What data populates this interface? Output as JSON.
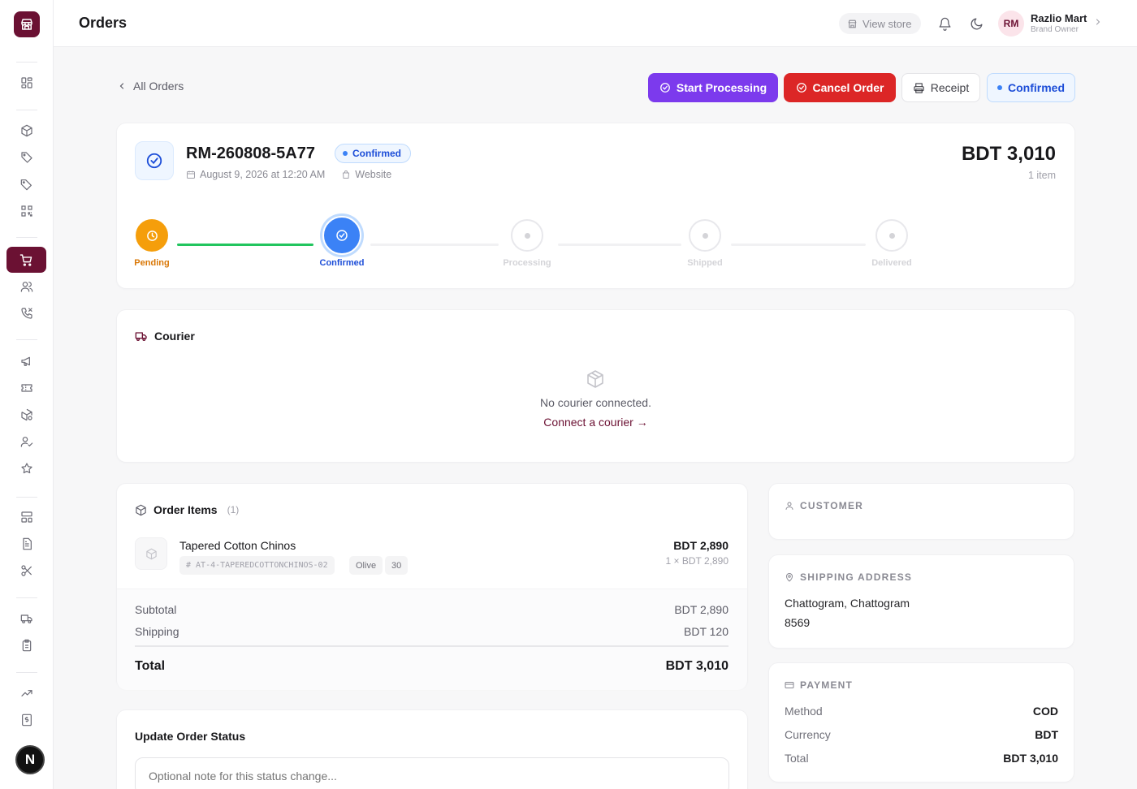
{
  "app": {
    "logo": "store-logo-icon"
  },
  "sidebar": {
    "icons": [
      "dashboard-icon",
      "package-icon",
      "tag-icon",
      "tags-icon",
      "qr-icon",
      "cart-icon",
      "users-icon",
      "phone-icon",
      "megaphone-icon",
      "ticket-icon",
      "box-gear-icon",
      "user-check-icon",
      "star-icon",
      "layout-icon",
      "document-icon",
      "scissors-icon",
      "truck-icon",
      "clipboard-icon",
      "trending-icon",
      "invoice-icon",
      "folder-icon"
    ],
    "active": "cart-icon",
    "avatar_letter": "N"
  },
  "header": {
    "title": "Orders",
    "view_store": "View store",
    "user": {
      "initials": "RM",
      "name": "Razlio Mart",
      "role": "Brand Owner"
    }
  },
  "actions": {
    "back": "All Orders",
    "start_processing": "Start Processing",
    "cancel_order": "Cancel Order",
    "receipt": "Receipt",
    "status": "Confirmed"
  },
  "order": {
    "id": "RM-260808-5A77",
    "status": "Confirmed",
    "date": "August 9, 2026 at 12:20 AM",
    "source": "Website",
    "total": "BDT 3,010",
    "item_count": "1 item",
    "steps": [
      {
        "label": "Pending",
        "state": "done"
      },
      {
        "label": "Confirmed",
        "state": "current"
      },
      {
        "label": "Processing",
        "state": "todo"
      },
      {
        "label": "Shipped",
        "state": "todo"
      },
      {
        "label": "Delivered",
        "state": "todo"
      }
    ]
  },
  "courier": {
    "title": "Courier",
    "empty": "No courier connected.",
    "link": "Connect a courier →"
  },
  "items": {
    "title": "Order Items",
    "count": "(1)",
    "list": [
      {
        "name": "Tapered Cotton Chinos",
        "sku": "# AT-4-TAPEREDCOTTONCHINOS-02",
        "color": "Olive",
        "size": "30",
        "price": "BDT 2,890",
        "qty_line": "1 × BDT 2,890"
      }
    ],
    "subtotal_label": "Subtotal",
    "subtotal": "BDT 2,890",
    "shipping_label": "Shipping",
    "shipping": "BDT 120",
    "total_label": "Total",
    "total": "BDT 3,010"
  },
  "status_update": {
    "title": "Update Order Status",
    "placeholder": "Optional note for this status change..."
  },
  "customer": {
    "title": "CUSTOMER"
  },
  "shipping_address": {
    "title": "SHIPPING ADDRESS",
    "line1": "Chattogram, Chattogram",
    "line2": "8569"
  },
  "payment": {
    "title": "PAYMENT",
    "method_label": "Method",
    "method": "COD",
    "currency_label": "Currency",
    "currency": "BDT",
    "total_label": "Total",
    "total": "BDT 3,010"
  },
  "colors": {
    "brand": "#6b1133",
    "primary": "#7c3aed",
    "danger": "#dc2626",
    "info": "#3b82f6",
    "success": "#22c55e",
    "warning": "#f59e0b"
  }
}
